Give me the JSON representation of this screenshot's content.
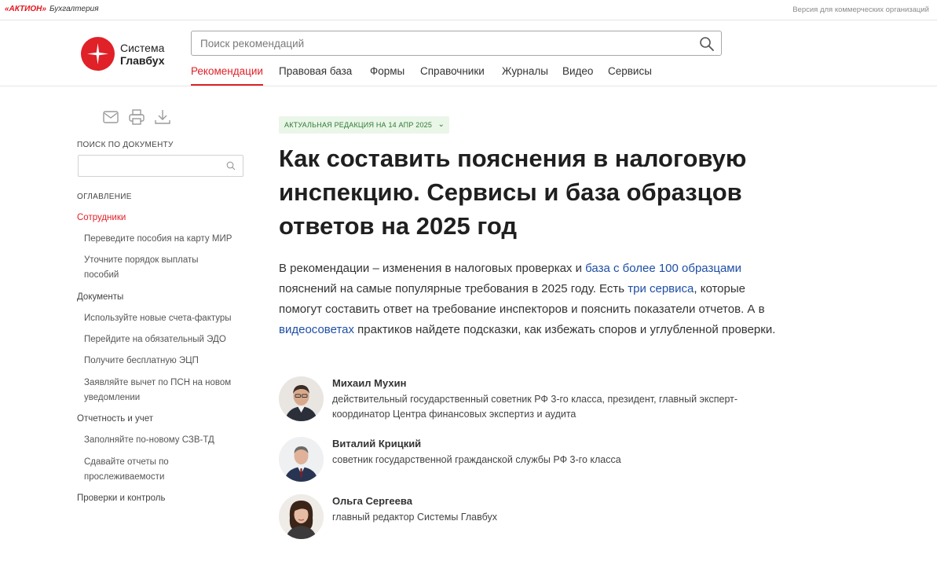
{
  "topbar": {
    "brand_aktion": "«АКТИОН»",
    "brand_section": "Бухгалтерия",
    "version_link": "Версия для коммерческих организаций"
  },
  "header": {
    "logo_line1": "Система",
    "logo_line2": "Главбух",
    "search_placeholder": "Поиск рекомендаций",
    "search_value": "",
    "nav": [
      "Рекомендации",
      "Правовая база",
      "Формы",
      "Справочники",
      "Журналы",
      "Видео",
      "Сервисы"
    ],
    "nav_active": "Рекомендации"
  },
  "sidebar": {
    "tools": [
      "mail-icon",
      "print-icon",
      "download-icon"
    ],
    "doc_search_label": "ПОИСК ПО ДОКУМЕНТУ",
    "doc_search_value": "",
    "toc_label": "ОГЛАВЛЕНИЕ",
    "toc": [
      {
        "label": "Сотрудники",
        "level": 1,
        "current": true
      },
      {
        "label": "Переведите пособия на карту МИР",
        "level": 2
      },
      {
        "label": "Уточните порядок выплаты пособий",
        "level": 2
      },
      {
        "label": "Документы",
        "level": 1
      },
      {
        "label": "Используйте новые счета-фактуры",
        "level": 2
      },
      {
        "label": "Перейдите на обязательный ЭДО",
        "level": 2
      },
      {
        "label": "Получите бесплатную ЭЦП",
        "level": 2
      },
      {
        "label": "Заявляйте вычет по ПСН на новом уведомлении",
        "level": 2
      },
      {
        "label": "Отчетность и учет",
        "level": 1
      },
      {
        "label": "Заполняйте по-новому СЗВ-ТД",
        "level": 2
      },
      {
        "label": "Сдавайте отчеты по прослеживаемости",
        "level": 2
      },
      {
        "label": "Проверки и контроль",
        "level": 1
      }
    ]
  },
  "article": {
    "edition_badge": "АКТУАЛЬНАЯ РЕДАКЦИЯ НА 14 АПР 2025",
    "title": "Как составить пояснения в налоговую инспекцию. Сервисы и база образцов ответов на 2025 год",
    "lead": {
      "p1": "В рекомендации – изменения в налоговых проверках и ",
      "link1": "база с более 100 образцами",
      "p2": " пояснений на самые популярные требования в 2025 году. Есть ",
      "link2": "три сервиса",
      "p3": ", которые помогут составить ответ на требование инспекторов и пояснить показатели отчетов. А в ",
      "link3": "видеосоветах",
      "p4": " практиков найдете подсказки, как избежать споров и углубленной проверки."
    },
    "authors": [
      {
        "name": "Михаил Мухин",
        "role": "действительный государственный советник РФ 3-го класса, президент, главный эксперт-координатор Центра финансовых экспертиз и аудита"
      },
      {
        "name": "Виталий Крицкий",
        "role": "советник государственной гражданской службы РФ 3-го класса"
      },
      {
        "name": "Ольга Сергеева",
        "role": "главный редактор Системы Главбух"
      }
    ]
  },
  "colors": {
    "accent_red": "#e02128",
    "link_blue": "#1f4fa5",
    "badge_bg": "#eaf6e8",
    "badge_text": "#2f7a34"
  }
}
